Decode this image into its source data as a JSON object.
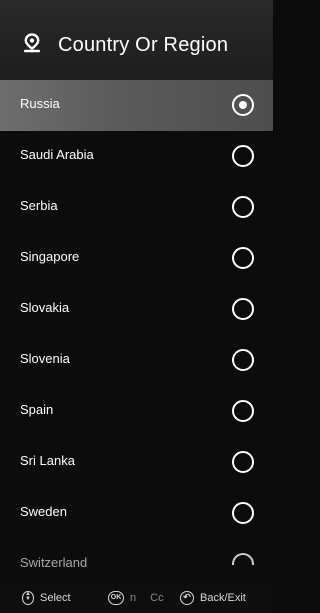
{
  "header": {
    "title": "Country Or Region",
    "icon": "location-pin-icon"
  },
  "countries": [
    {
      "label": "Russia",
      "selected": true
    },
    {
      "label": "Saudi Arabia",
      "selected": false
    },
    {
      "label": "Serbia",
      "selected": false
    },
    {
      "label": "Singapore",
      "selected": false
    },
    {
      "label": "Slovakia",
      "selected": false
    },
    {
      "label": "Slovenia",
      "selected": false
    },
    {
      "label": "Spain",
      "selected": false
    },
    {
      "label": "Sri Lanka",
      "selected": false
    },
    {
      "label": "Sweden",
      "selected": false
    },
    {
      "label": "Switzerland",
      "selected": false
    }
  ],
  "footer": {
    "select_label": "Select",
    "confirm_fragment_1": "n",
    "confirm_fragment_2": "Cc",
    "back_label": "Back/Exit",
    "ok_key": "OK"
  },
  "colors": {
    "background": "#0c0c0c",
    "header": "#222222",
    "selected_row": "#5e5e5e",
    "text": "#ffffff"
  }
}
